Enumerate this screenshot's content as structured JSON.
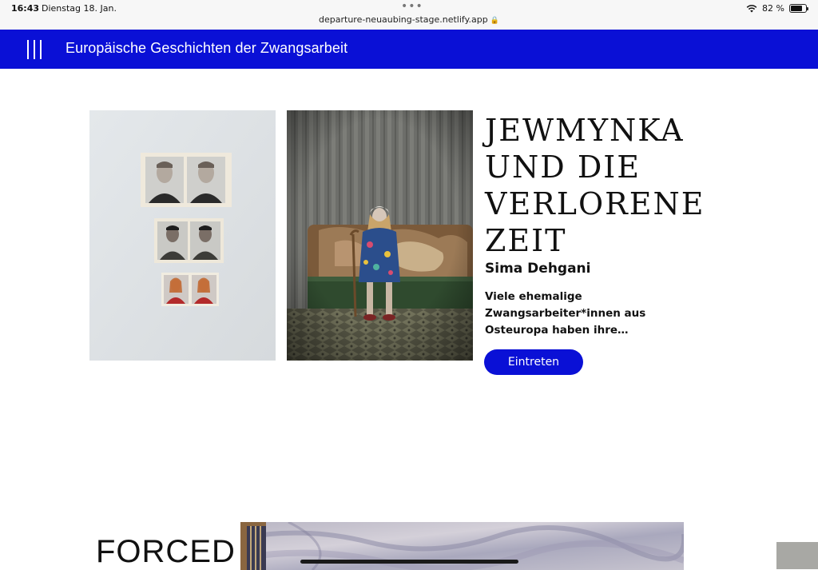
{
  "status_bar": {
    "time": "16:43",
    "date": "Dienstag 18. Jan.",
    "dots": "•••",
    "url": "departure-neuaubing-stage.netlify.app",
    "lock_icon": "lock-icon",
    "wifi_icon": "wifi-icon",
    "battery": "82 %",
    "battery_level": 0.82
  },
  "nav": {
    "menu_icon": "menu-icon",
    "title": "Europäische Geschichten der Zwangsarbeit",
    "color": "#0a10d6"
  },
  "story": {
    "title": "JEWMYNKA UND DIE VERLORENE ZEIT",
    "author": "Sima Dehgani",
    "teaser": "Viele ehemalige Zwangsarbeiter*innen aus Osteuropa haben ihre…",
    "button_label": "Eintreten"
  },
  "next_section": {
    "heading": "FORCED"
  }
}
